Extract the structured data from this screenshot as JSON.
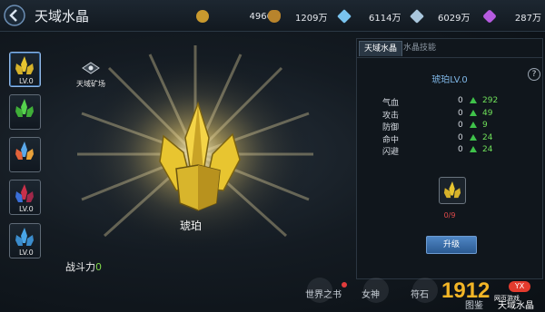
{
  "header": {
    "title": "天域水晶",
    "resources": [
      {
        "icon": "gold-coin-icon",
        "value": "4966",
        "color": "#c9992e"
      },
      {
        "icon": "coin-bag-icon",
        "value": "1209万",
        "color": "#b8842c"
      },
      {
        "icon": "blue-diamond-icon",
        "value": "6114万",
        "color": "#79c3ee"
      },
      {
        "icon": "silver-diamond-icon",
        "value": "6029万",
        "color": "#a9c6dc"
      },
      {
        "icon": "purple-gem-icon",
        "value": "287万",
        "color": "#b65be0"
      }
    ]
  },
  "sidebar": {
    "items": [
      {
        "name": "amber",
        "level": "LV.0",
        "color": "#e8c530",
        "selected": true
      },
      {
        "name": "green",
        "level": "",
        "color": "#55d24d",
        "selected": false
      },
      {
        "name": "fire",
        "level": "",
        "color": "#e2623a",
        "selected": false
      },
      {
        "name": "red",
        "level": "LV.0",
        "color": "#c9304a",
        "selected": false
      },
      {
        "name": "blue",
        "level": "LV.0",
        "color": "#49a6e8",
        "selected": false
      }
    ]
  },
  "center": {
    "mine_label": "天域矿场",
    "crystal_name": "琥珀",
    "power_label": "战斗力",
    "power_value": "0"
  },
  "panel": {
    "tabs": [
      "天域水晶",
      "水晶技能"
    ],
    "help": "?",
    "crystal_level": "琥珀LV.0",
    "stats": [
      {
        "name": "气血",
        "current": "0",
        "next": "292"
      },
      {
        "name": "攻击",
        "current": "0",
        "next": "49"
      },
      {
        "name": "防御",
        "current": "0",
        "next": "9"
      },
      {
        "name": "命中",
        "current": "0",
        "next": "24"
      },
      {
        "name": "闪避",
        "current": "0",
        "next": "24"
      }
    ],
    "progress": "0/9",
    "upgrade_label": "升级"
  },
  "bottom_nav": [
    "世界之书",
    "女神",
    "符石",
    "图鉴",
    "天域水晶"
  ],
  "watermark": {
    "big": "1912",
    "badge": "YX",
    "sub": "网页游戏"
  }
}
